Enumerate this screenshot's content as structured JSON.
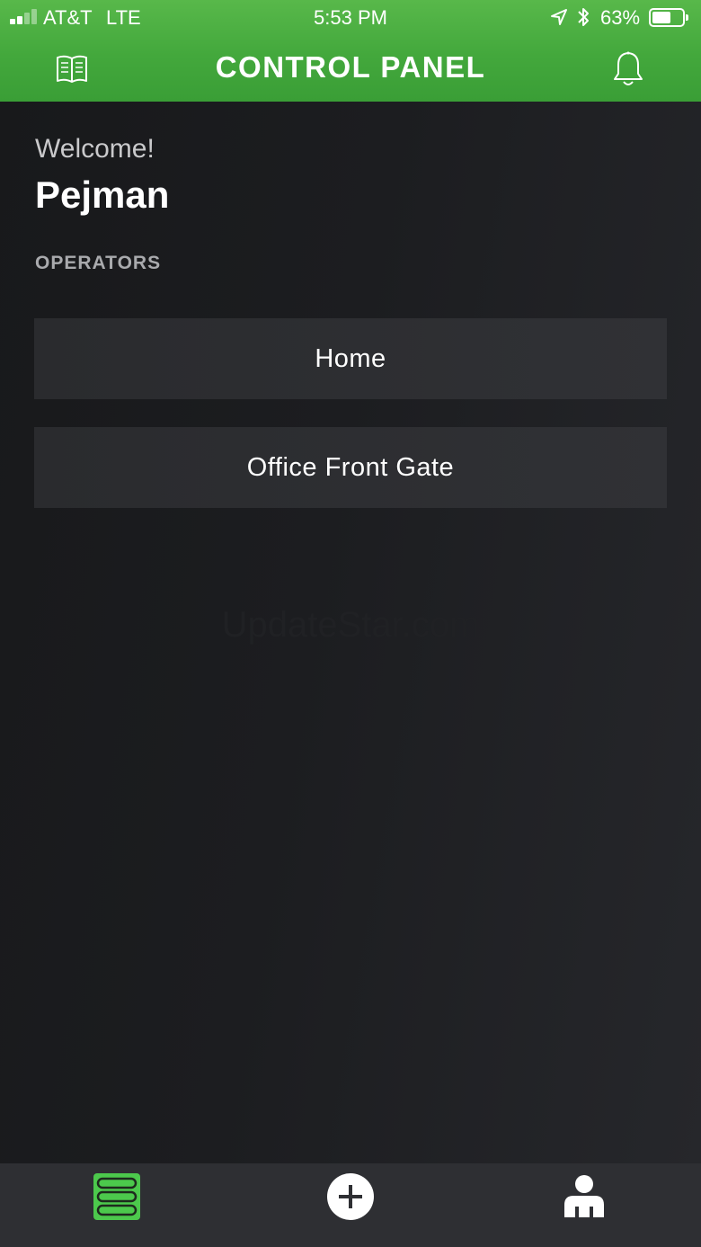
{
  "status_bar": {
    "carrier": "AT&T",
    "network": "LTE",
    "time": "5:53 PM",
    "battery_percent": "63%",
    "battery_level": 0.63
  },
  "header": {
    "title": "CONTROL PANEL",
    "left_icon": "book-icon",
    "right_icon": "bell-icon",
    "accent_color": "#4caf45"
  },
  "main": {
    "welcome": "Welcome!",
    "username": "Pejman",
    "section_label": "OPERATORS",
    "operators": [
      {
        "label": "Home"
      },
      {
        "label": "Office Front Gate"
      }
    ],
    "watermark": "UpdateStar.com"
  },
  "tabbar": {
    "active_color": "#4cc94c",
    "tabs": [
      {
        "icon": "operators-list-icon",
        "active": true
      },
      {
        "icon": "add-circle-icon",
        "active": false
      },
      {
        "icon": "account-icon",
        "active": false
      }
    ]
  }
}
